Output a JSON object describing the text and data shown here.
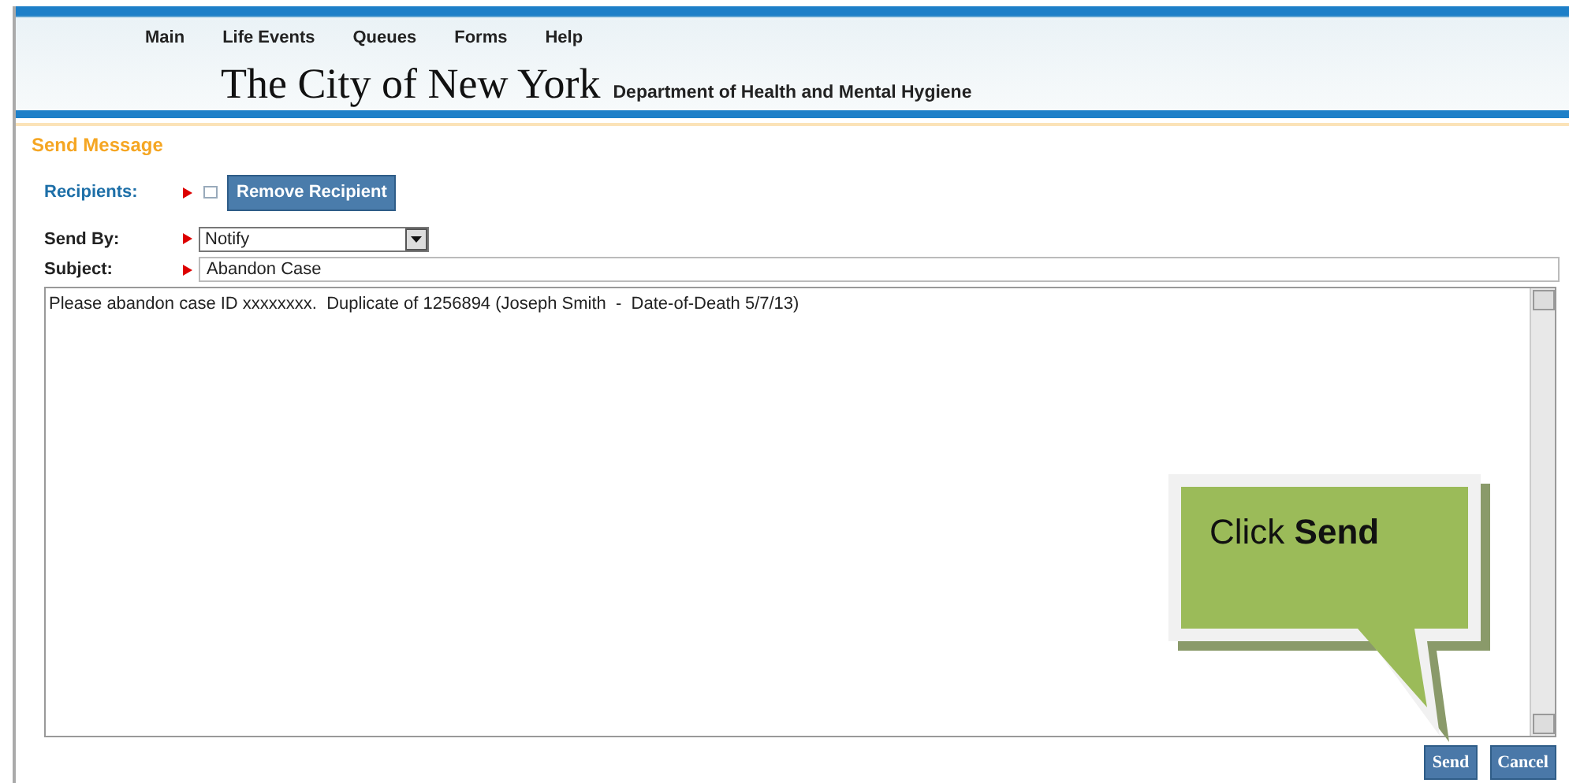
{
  "menu": [
    {
      "label": "Main"
    },
    {
      "label": "Life Events"
    },
    {
      "label": "Queues"
    },
    {
      "label": "Forms"
    },
    {
      "label": "Help"
    }
  ],
  "header": {
    "title": "The City of New York",
    "subtitle": "Department of Health and Mental Hygiene"
  },
  "section_title": "Send Message",
  "recipients": {
    "label": "Recipients:",
    "checked": false,
    "button": "Remove Recipient"
  },
  "send_by": {
    "label": "Send By:",
    "value": "Notify"
  },
  "subject": {
    "label": "Subject:",
    "value": "Abandon Case"
  },
  "message": "Please abandon case ID xxxxxxxx.  Duplicate of 1256894 (Joseph Smith  -  Date-of-Death 5/7/13)",
  "buttons": [
    "Send",
    "Cancel"
  ],
  "callout": "Click **Send**"
}
